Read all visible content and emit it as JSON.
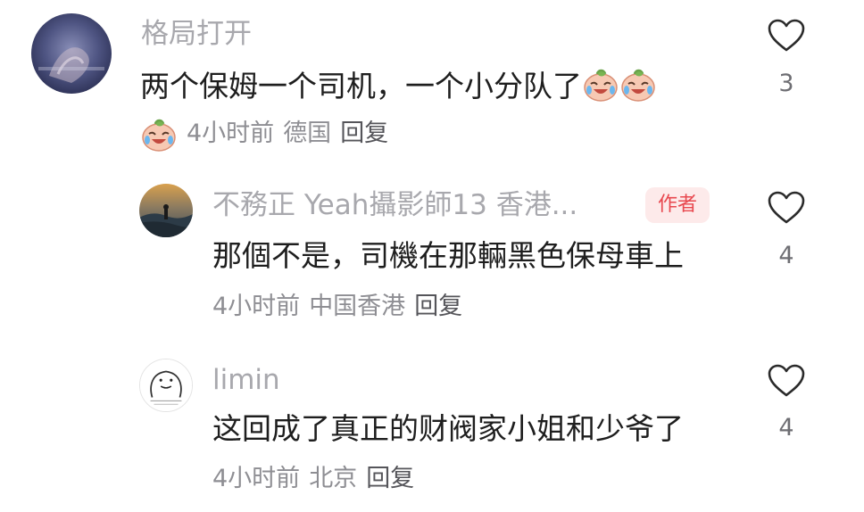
{
  "comments": [
    {
      "username": "格局打开",
      "content": "两个保姆一个司机，一个小分队了",
      "content_emojis": [
        "crying-laugh-emoji",
        "crying-laugh-emoji"
      ],
      "meta_emoji": "crying-laugh-emoji",
      "time": "4小时前",
      "location": "德国",
      "reply_label": "回复",
      "likes": "3"
    },
    {
      "username": "不務正 Yeah攝影師13 香港...",
      "author_badge": "作者",
      "content": "那個不是，司機在那輛黑色保母車上",
      "time": "4小时前",
      "location": "中国香港",
      "reply_label": "回复",
      "likes": "4"
    },
    {
      "username": "limin",
      "content": "这回成了真正的财阀家小姐和少爷了",
      "time": "4小时前",
      "location": "北京",
      "reply_label": "回复",
      "likes": "4"
    }
  ],
  "icons": {
    "like": "heart-outline-icon",
    "emoji": "crying-laugh-emoji"
  },
  "colors": {
    "username": "#a8a8ad",
    "content": "#1e1e1e",
    "meta": "#8e8e93",
    "author_badge_bg": "#fdeaea",
    "author_badge_text": "#e8484f"
  }
}
